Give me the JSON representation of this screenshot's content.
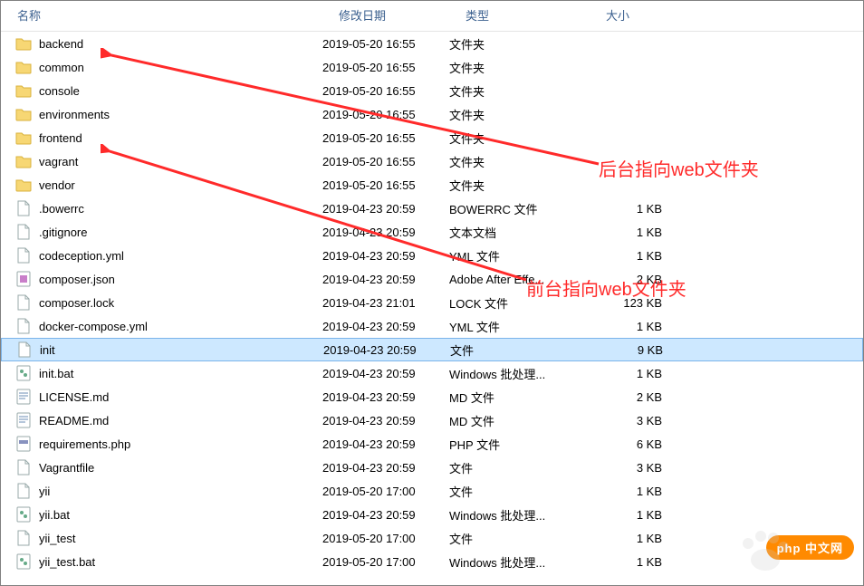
{
  "header": {
    "name": "名称",
    "date": "修改日期",
    "type": "类型",
    "size": "大小"
  },
  "annotations": {
    "a1": "后台指向web文件夹",
    "a2": "前台指向web文件夹"
  },
  "badge": "php 中文网",
  "colors": {
    "annotation": "#ff2a2a",
    "folder": "#f7d774",
    "headerText": "#3a5f8e",
    "selection": "#cde8ff"
  },
  "rows": [
    {
      "icon": "folder",
      "name": "backend",
      "date": "2019-05-20 16:55",
      "type": "文件夹",
      "size": ""
    },
    {
      "icon": "folder",
      "name": "common",
      "date": "2019-05-20 16:55",
      "type": "文件夹",
      "size": ""
    },
    {
      "icon": "folder",
      "name": "console",
      "date": "2019-05-20 16:55",
      "type": "文件夹",
      "size": ""
    },
    {
      "icon": "folder",
      "name": "environments",
      "date": "2019-05-20 16:55",
      "type": "文件夹",
      "size": ""
    },
    {
      "icon": "folder",
      "name": "frontend",
      "date": "2019-05-20 16:55",
      "type": "文件夹",
      "size": ""
    },
    {
      "icon": "folder",
      "name": "vagrant",
      "date": "2019-05-20 16:55",
      "type": "文件夹",
      "size": ""
    },
    {
      "icon": "folder",
      "name": "vendor",
      "date": "2019-05-20 16:55",
      "type": "文件夹",
      "size": ""
    },
    {
      "icon": "file",
      "name": ".bowerrc",
      "date": "2019-04-23 20:59",
      "type": "BOWERRC 文件",
      "size": "1 KB"
    },
    {
      "icon": "file",
      "name": ".gitignore",
      "date": "2019-04-23 20:59",
      "type": "文本文档",
      "size": "1 KB"
    },
    {
      "icon": "file",
      "name": "codeception.yml",
      "date": "2019-04-23 20:59",
      "type": "YML 文件",
      "size": "1 KB"
    },
    {
      "icon": "json",
      "name": "composer.json",
      "date": "2019-04-23 20:59",
      "type": "Adobe After Effe...",
      "size": "2 KB"
    },
    {
      "icon": "file",
      "name": "composer.lock",
      "date": "2019-04-23 21:01",
      "type": "LOCK 文件",
      "size": "123 KB"
    },
    {
      "icon": "file",
      "name": "docker-compose.yml",
      "date": "2019-04-23 20:59",
      "type": "YML 文件",
      "size": "1 KB"
    },
    {
      "icon": "file",
      "name": "init",
      "date": "2019-04-23 20:59",
      "type": "文件",
      "size": "9 KB",
      "selected": true
    },
    {
      "icon": "bat",
      "name": "init.bat",
      "date": "2019-04-23 20:59",
      "type": "Windows 批处理...",
      "size": "1 KB"
    },
    {
      "icon": "md",
      "name": "LICENSE.md",
      "date": "2019-04-23 20:59",
      "type": "MD 文件",
      "size": "2 KB"
    },
    {
      "icon": "md",
      "name": "README.md",
      "date": "2019-04-23 20:59",
      "type": "MD 文件",
      "size": "3 KB"
    },
    {
      "icon": "php",
      "name": "requirements.php",
      "date": "2019-04-23 20:59",
      "type": "PHP 文件",
      "size": "6 KB"
    },
    {
      "icon": "file",
      "name": "Vagrantfile",
      "date": "2019-04-23 20:59",
      "type": "文件",
      "size": "3 KB"
    },
    {
      "icon": "file",
      "name": "yii",
      "date": "2019-05-20 17:00",
      "type": "文件",
      "size": "1 KB"
    },
    {
      "icon": "bat",
      "name": "yii.bat",
      "date": "2019-04-23 20:59",
      "type": "Windows 批处理...",
      "size": "1 KB"
    },
    {
      "icon": "file",
      "name": "yii_test",
      "date": "2019-05-20 17:00",
      "type": "文件",
      "size": "1 KB"
    },
    {
      "icon": "bat",
      "name": "yii_test.bat",
      "date": "2019-05-20 17:00",
      "type": "Windows 批处理...",
      "size": "1 KB"
    }
  ]
}
